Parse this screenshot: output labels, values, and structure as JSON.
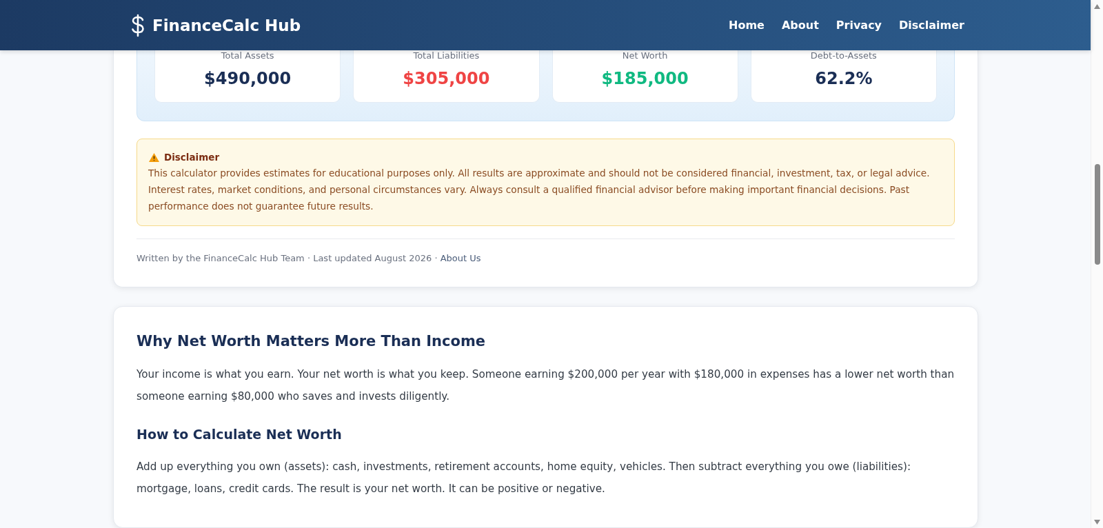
{
  "header": {
    "logo": "FinanceCalc Hub",
    "nav": [
      {
        "label": "Home"
      },
      {
        "label": "About"
      },
      {
        "label": "Privacy"
      },
      {
        "label": "Disclaimer"
      }
    ]
  },
  "results": [
    {
      "label": "Total Assets",
      "value": "$490,000",
      "color": "#1a2e55"
    },
    {
      "label": "Total Liabilities",
      "value": "$305,000",
      "color": "#ef4444"
    },
    {
      "label": "Net Worth",
      "value": "$185,000",
      "color": "#10b981"
    },
    {
      "label": "Debt-to-Assets",
      "value": "62.2%",
      "color": "#1a2e55"
    }
  ],
  "disclaimer": {
    "title": "Disclaimer",
    "text": "This calculator provides estimates for educational purposes only. All results are approximate and should not be considered financial, investment, tax, or legal advice. Interest rates, market conditions, and personal circumstances vary. Always consult a qualified financial advisor before making important financial decisions. Past performance does not guarantee future results."
  },
  "byline": {
    "text": "Written by the FinanceCalc Hub Team · Last updated August 2026 · ",
    "link": "About Us"
  },
  "article": [
    {
      "heading": "Why Net Worth Matters More Than Income",
      "paragraph": "Your income is what you earn. Your net worth is what you keep. Someone earning $200,000 per year with $180,000 in expenses has a lower net worth than someone earning $80,000 who saves and invests diligently."
    },
    {
      "heading": "How to Calculate Net Worth",
      "paragraph": "Add up everything you own (assets): cash, investments, retirement accounts, home equity, vehicles. Then subtract everything you owe (liabilities): mortgage, loans, credit cards. The result is your net worth. It can be positive or negative."
    }
  ]
}
